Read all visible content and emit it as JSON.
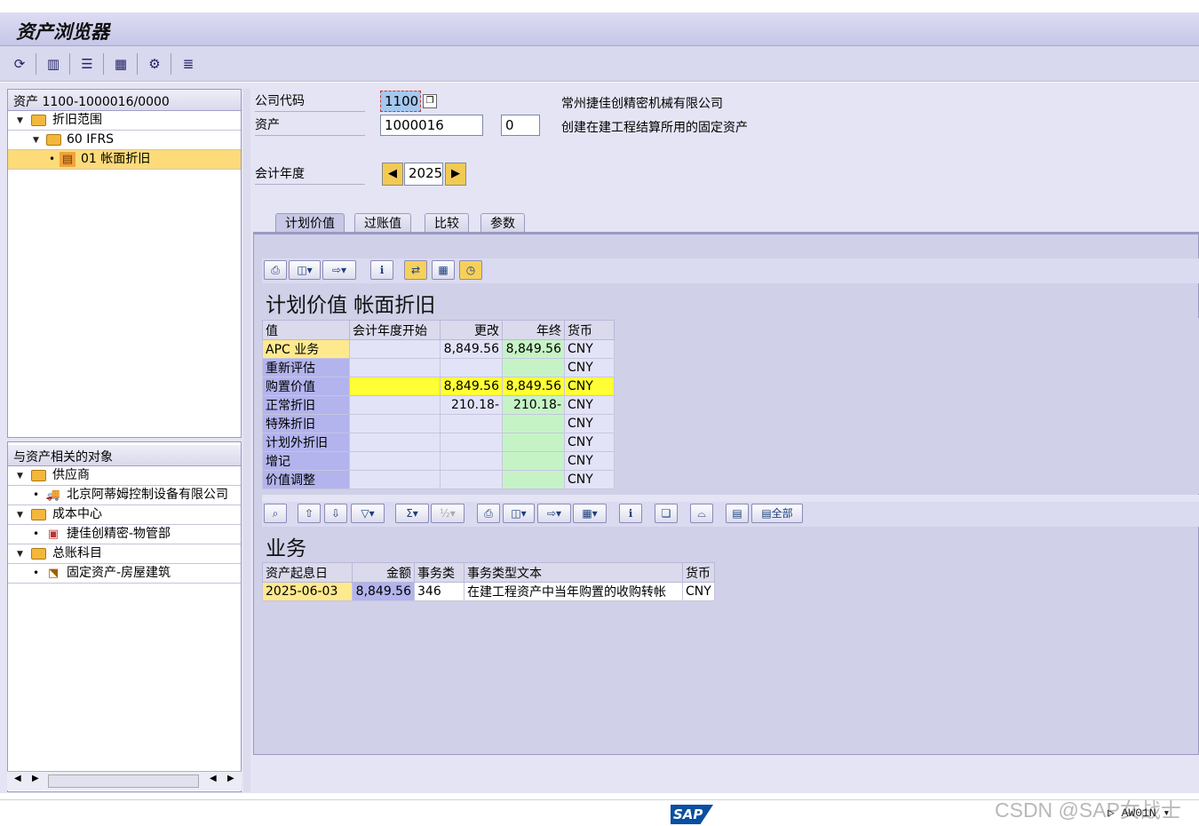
{
  "app": {
    "title": "资产浏览器"
  },
  "toolbar": {
    "icons": [
      "refresh-icon",
      "save-icon",
      "display-icon",
      "layout-icon",
      "settings-icon",
      "list-icon"
    ]
  },
  "tree": {
    "header": "资产 1100-1000016/0000",
    "items": [
      {
        "label": "折旧范围"
      },
      {
        "label": "60  IFRS"
      },
      {
        "label": "01  帐面折旧"
      }
    ]
  },
  "related": {
    "header": "与资产相关的对象",
    "groups": [
      {
        "label": "供应商",
        "child": "北京阿蒂姆控制设备有限公司"
      },
      {
        "label": "成本中心",
        "child": "捷佳创精密-物管部"
      },
      {
        "label": "总账科目",
        "child": "固定资产-房屋建筑"
      }
    ]
  },
  "header_fields": {
    "company_code_label": "公司代码",
    "company_code": "1100",
    "company_name": "常州捷佳创精密机械有限公司",
    "asset_label": "资产",
    "asset_number": "1000016",
    "asset_sub": "0",
    "asset_desc": "创建在建工程结算所用的固定资产",
    "fiscal_year_label": "会计年度",
    "fiscal_year": "2025"
  },
  "tabs": [
    "计划价值",
    "过账值",
    "比较",
    "参数"
  ],
  "planned": {
    "title": "计划价值 帐面折旧",
    "columns": [
      "值",
      "会计年度开始",
      "更改",
      "年终",
      "货币"
    ],
    "rows": [
      [
        "APC 业务",
        "",
        "8,849.56",
        "8,849.56",
        "CNY"
      ],
      [
        "重新评估",
        "",
        "",
        "",
        "CNY"
      ],
      [
        "购置价值",
        "",
        "8,849.56",
        "8,849.56",
        "CNY"
      ],
      [
        "正常折旧",
        "",
        "210.18-",
        "210.18-",
        "CNY"
      ],
      [
        "特殊折旧",
        "",
        "",
        "",
        "CNY"
      ],
      [
        "计划外折旧",
        "",
        "",
        "",
        "CNY"
      ],
      [
        "增记",
        "",
        "",
        "",
        "CNY"
      ],
      [
        "价值调整",
        "",
        "",
        "",
        "CNY"
      ]
    ]
  },
  "transactions": {
    "title": "业务",
    "all_label": "全部",
    "columns": [
      "资产起息日",
      "金额",
      "事务类",
      "事务类型文本",
      "货币"
    ],
    "rows": [
      [
        "2025-06-03",
        "8,849.56",
        "346",
        "在建工程资产中当年购置的收购转帐",
        "CNY"
      ]
    ]
  },
  "status": {
    "logo": "SAP",
    "tcode": "AW01N",
    "watermark": "CSDN @SAP女战士"
  }
}
